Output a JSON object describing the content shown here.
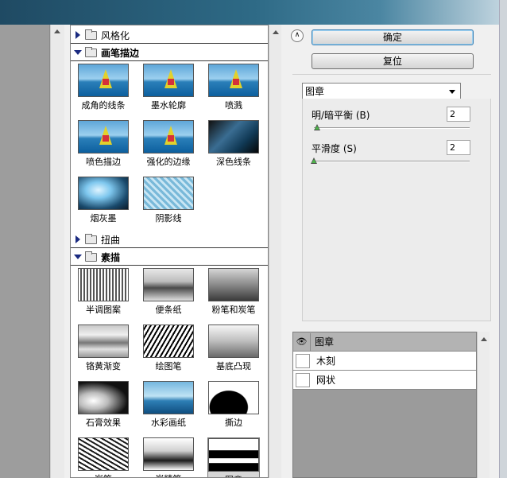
{
  "filter_gallery": {
    "folders": [
      {
        "label": "风格化",
        "expanded": false
      },
      {
        "label": "画笔描边",
        "expanded": true
      },
      {
        "label": "扭曲",
        "expanded": false
      },
      {
        "label": "素描",
        "expanded": true
      }
    ],
    "brush_strokes": [
      {
        "label": "成角的线条",
        "style": "color"
      },
      {
        "label": "墨水轮廓",
        "style": "color"
      },
      {
        "label": "喷溅",
        "style": "color"
      },
      {
        "label": "喷色描边",
        "style": "color"
      },
      {
        "label": "强化的边缘",
        "style": "color"
      },
      {
        "label": "深色线条",
        "style": "dark"
      },
      {
        "label": "烟灰墨",
        "style": "smoke"
      },
      {
        "label": "阴影线",
        "style": "cross"
      }
    ],
    "sketch": [
      {
        "label": "半调图案",
        "style": "gray1"
      },
      {
        "label": "便条纸",
        "style": "gray2"
      },
      {
        "label": "粉笔和炭笔",
        "style": "gray3"
      },
      {
        "label": "铬黄渐变",
        "style": "chrome"
      },
      {
        "label": "绘图笔",
        "style": "scratch"
      },
      {
        "label": "基底凸现",
        "style": "relief"
      },
      {
        "label": "石膏效果",
        "style": "plaster"
      },
      {
        "label": "水彩画纸",
        "style": "water"
      },
      {
        "label": "撕边",
        "style": "torn"
      },
      {
        "label": "炭笔",
        "style": "chalk"
      },
      {
        "label": "炭精笔",
        "style": "charcoal"
      },
      {
        "label": "图章",
        "style": "stamp",
        "selected": true
      }
    ]
  },
  "buttons": {
    "ok": "确定",
    "reset": "复位"
  },
  "filter_select": {
    "value": "图章"
  },
  "params": [
    {
      "label": "明/暗平衡 (B)",
      "value": "2",
      "level": 0.02
    },
    {
      "label": "平滑度 (S)",
      "value": "2",
      "level": 0.0
    }
  ],
  "layers": [
    {
      "name": "图章",
      "visible": true,
      "active": true
    },
    {
      "name": "木刻",
      "visible": false,
      "active": false
    },
    {
      "name": "网状",
      "visible": false,
      "active": false
    }
  ]
}
